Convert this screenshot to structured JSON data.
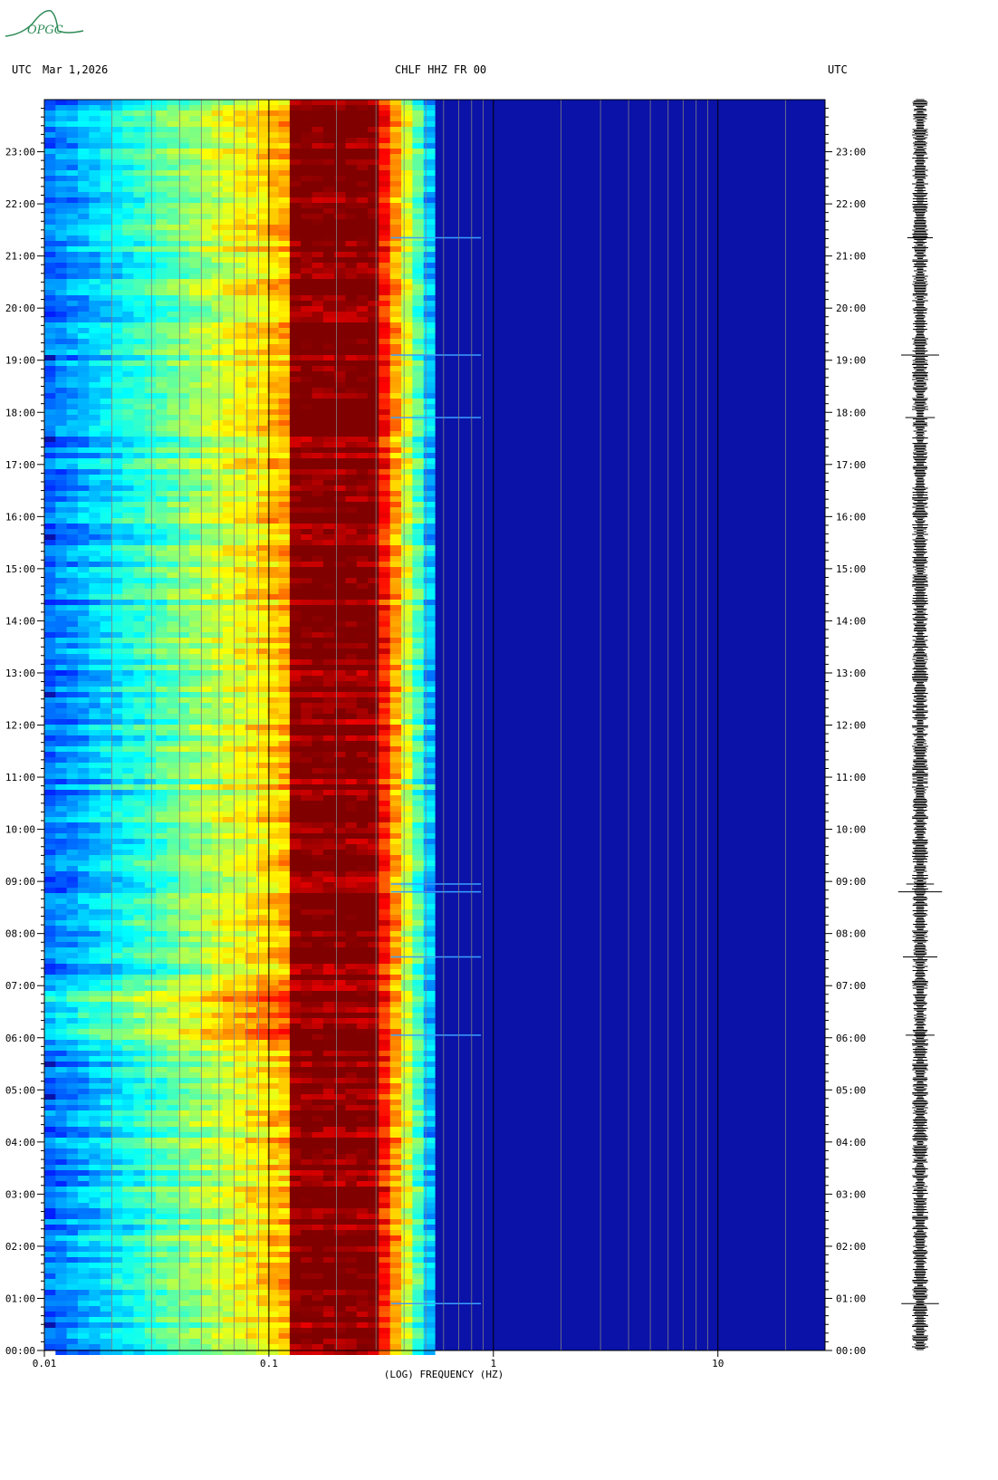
{
  "header": {
    "left_tz": "UTC",
    "date": "Mar 1,2026",
    "station": "CHLF HHZ FR 00",
    "right_tz": "UTC"
  },
  "logo": {
    "text": "OPGC"
  },
  "colors": {
    "background": "#0a12a8",
    "low_band": "#1e90ff",
    "peak_band": "#8b0000",
    "grid": "#808080"
  },
  "chart_data": {
    "type": "heatmap",
    "title": "CHLF HHZ FR 00",
    "xlabel": "(LOG) FREQUENCY (HZ)",
    "ylabel": "UTC",
    "x_scale": "log",
    "xlim": [
      0.01,
      30
    ],
    "x_tick_values": [
      0.01,
      0.1,
      1,
      10
    ],
    "x_tick_labels": [
      "0.01",
      "0.1",
      "1",
      "10"
    ],
    "ylim_hours": [
      0,
      24
    ],
    "y_tick_labels": [
      "00:00",
      "01:00",
      "02:00",
      "03:00",
      "04:00",
      "05:00",
      "06:00",
      "07:00",
      "08:00",
      "09:00",
      "10:00",
      "11:00",
      "12:00",
      "13:00",
      "14:00",
      "15:00",
      "16:00",
      "17:00",
      "18:00",
      "19:00",
      "20:00",
      "21:00",
      "22:00",
      "23:00"
    ],
    "peak_band_hz": [
      0.12,
      0.3
    ],
    "noise_edge_hz": 0.55,
    "events_utc_hours": [
      0.9,
      6.05,
      7.55,
      8.8,
      8.95,
      17.9,
      19.1,
      21.35
    ]
  }
}
